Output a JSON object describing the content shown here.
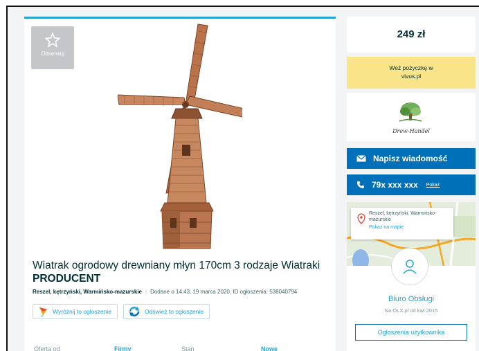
{
  "gallery": {
    "watch_label": "Obserwuj"
  },
  "ad": {
    "title_line1": "Wiatrak ogrodowy drewniany młyn 170cm 3 rodzaje Wiatraki",
    "title_line2": "PRODUCENT",
    "location": "Reszel, kętrzyński, Warmińsko-mazurskie",
    "added": "Dodane o 14:43, 19 marca 2020, ID ogłoszenia: 538040794"
  },
  "promo": {
    "highlight_label": "Wyróżnij to ogłoszenie",
    "refresh_label": "Odśwież to ogłoszenie"
  },
  "params": [
    {
      "key": "Oferta od",
      "value": "Firmy"
    },
    {
      "key": "Stan",
      "value": "Nowe"
    }
  ],
  "sidebar": {
    "price": "249 zł",
    "loan_line1": "Weź pożyczkę w",
    "loan_line2": "vivus.pl",
    "seller_logo_text": "Drew-Handel",
    "message_button": "Napisz wiadomość",
    "phone_number": "79x xxx xxx",
    "phone_show": "Pokaż",
    "map_location": "Reszel, kętrzyński, Warmińsko-mazurskie",
    "map_show": "Pokaż na mapie",
    "seller_name": "Biuro Obsługi",
    "seller_since": "Na OLX.pl od kwi 2015",
    "user_ads_button": "Ogłoszenia użytkownika"
  },
  "colors": {
    "accent": "#23a3d3",
    "primary_button": "#0071b9",
    "loan_bg": "#f9e48a",
    "text": "#002f34"
  }
}
